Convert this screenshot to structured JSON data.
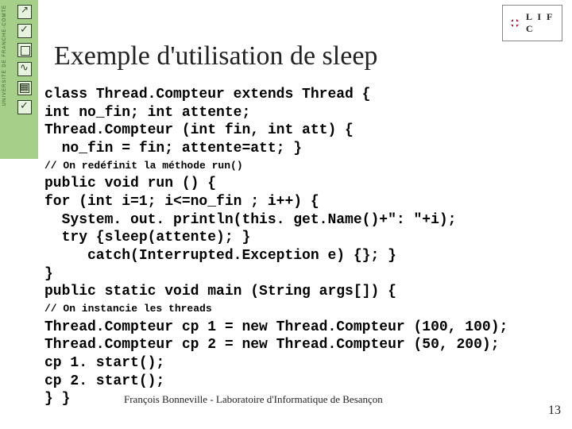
{
  "sidebar": {
    "label": "UNIVERSITÉ DE FRANCHE-COMTÉ"
  },
  "logo": {
    "text": "L I F C"
  },
  "title": "Exemple d'utilisation de sleep",
  "code": {
    "block1": "class Thread.Compteur extends Thread {\nint no_fin; int attente;\nThread.Compteur (int fin, int att) {\n  no_fin = fin; attente=att; }",
    "comment1": "// On redéfinit la méthode run()",
    "block2": "public void run () {\nfor (int i=1; i<=no_fin ; i++) {\n  System. out. println(this. get.Name()+\": \"+i);\n  try {sleep(attente); }\n     catch(Interrupted.Exception e) {}; }\n}\npublic static void main (String args[]) {",
    "comment2": "// On instancie les threads",
    "block3": "Thread.Compteur cp 1 = new Thread.Compteur (100, 100);\nThread.Compteur cp 2 = new Thread.Compteur (50, 200);\ncp 1. start();\ncp 2. start();\n} }"
  },
  "footer": "François Bonneville - Laboratoire d'Informatique de Besançon",
  "page_number": "13"
}
